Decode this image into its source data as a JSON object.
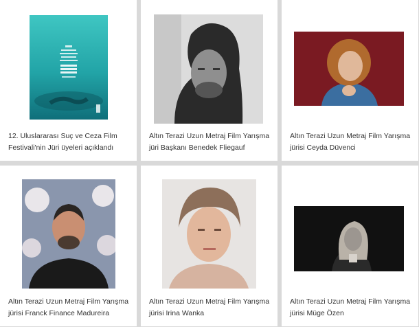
{
  "cards": [
    {
      "caption_line1": "12. Uluslararası Suç ve Ceza Film",
      "caption_line2": "Festivali'nin Jüri üyeleri açıklandı",
      "poster_text": "12. ULUSLARARASI SUÇ VE CEZA FİLM FESTİVALİ CRIME AND PUNISHMENT FILM FESTIVAL İSTANBUL"
    },
    {
      "caption_line1": "Altın Terazi Uzun Metraj Film Yarışma",
      "caption_line2": "jüri Başkanı Benedek Fliegauf"
    },
    {
      "caption_line1": "Altın Terazi Uzun Metraj Film Yarışma",
      "caption_line2": "jürisi Ceyda Düvenci"
    },
    {
      "caption_line1": "Altın Terazi Uzun Metraj Film Yarışma",
      "caption_line2": "jürisi Franck Finance Madureira"
    },
    {
      "caption_line1": "Altın Terazi Uzun Metraj Film Yarışma",
      "caption_line2": "jürisi Irina Wanka"
    },
    {
      "caption_line1": "Altın Terazi Uzun Metraj Film Yarışma",
      "caption_line2": "jürisi Müge Özen"
    }
  ],
  "colors": {
    "page_bg": "#d9d9d9",
    "card_bg": "#ffffff",
    "caption": "#333333",
    "poster_teal": "#2fb7b0",
    "portrait_red_bg": "#7a1a22"
  }
}
